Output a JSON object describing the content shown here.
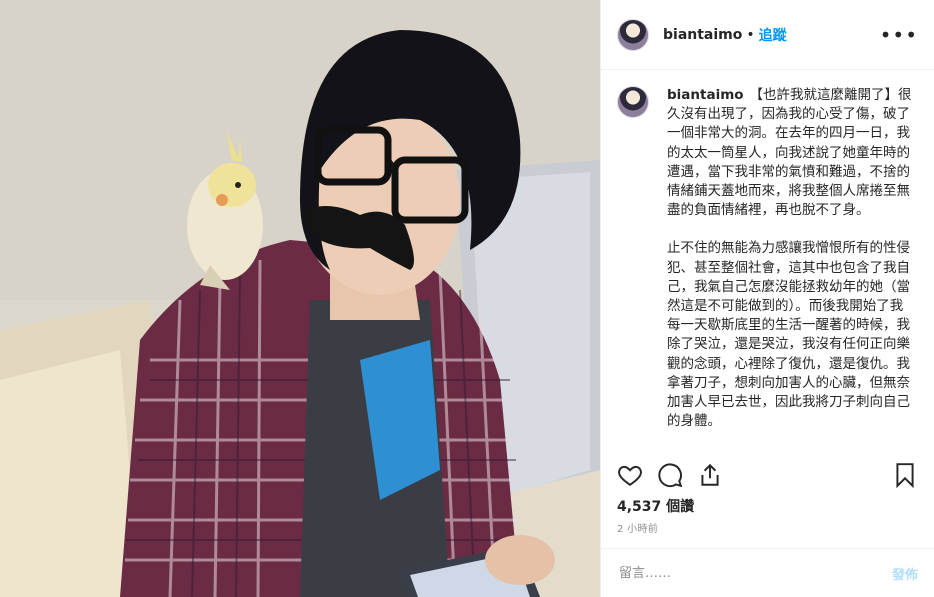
{
  "post": {
    "username": "biantaimo",
    "separator": "•",
    "follow_label": "追蹤",
    "more_label": "•••",
    "caption_user": "biantaimo",
    "caption_paragraphs": [
      "【也許我就這麼離開了】很久沒有出現了，因為我的心受了傷，破了一個非常大的洞。在去年的四月一日，我的太太一筒星人，向我述說了她童年時的遭遇，當下我非常的氣憤和難過，不捨的情緒鋪天蓋地而來，將我整個人席捲至無盡的負面情緒裡，再也脫不了身。",
      "止不住的無能為力感讓我憎恨所有的性侵犯、甚至整個社會，這其中也包含了我自己，我氣自己怎麼沒能拯救幼年的她（當然這是不可能做到的）。而後我開始了我每一天歇斯底里的生活一醒著的時候，我除了哭泣，還是哭泣，我沒有任何正向樂觀的念頭，心裡除了復仇，還是復仇。我拿著刀子，想刺向加害人的心臟，但無奈加害人早已去世，因此我將刀子刺向自己的身體。"
    ],
    "views": "4,537 個讚",
    "time": "2 小時前"
  },
  "comment": {
    "placeholder": "留言……",
    "post_label": "發佈"
  },
  "colors": {
    "accent": "#0095f6",
    "post_disabled": "#b2dffc"
  }
}
